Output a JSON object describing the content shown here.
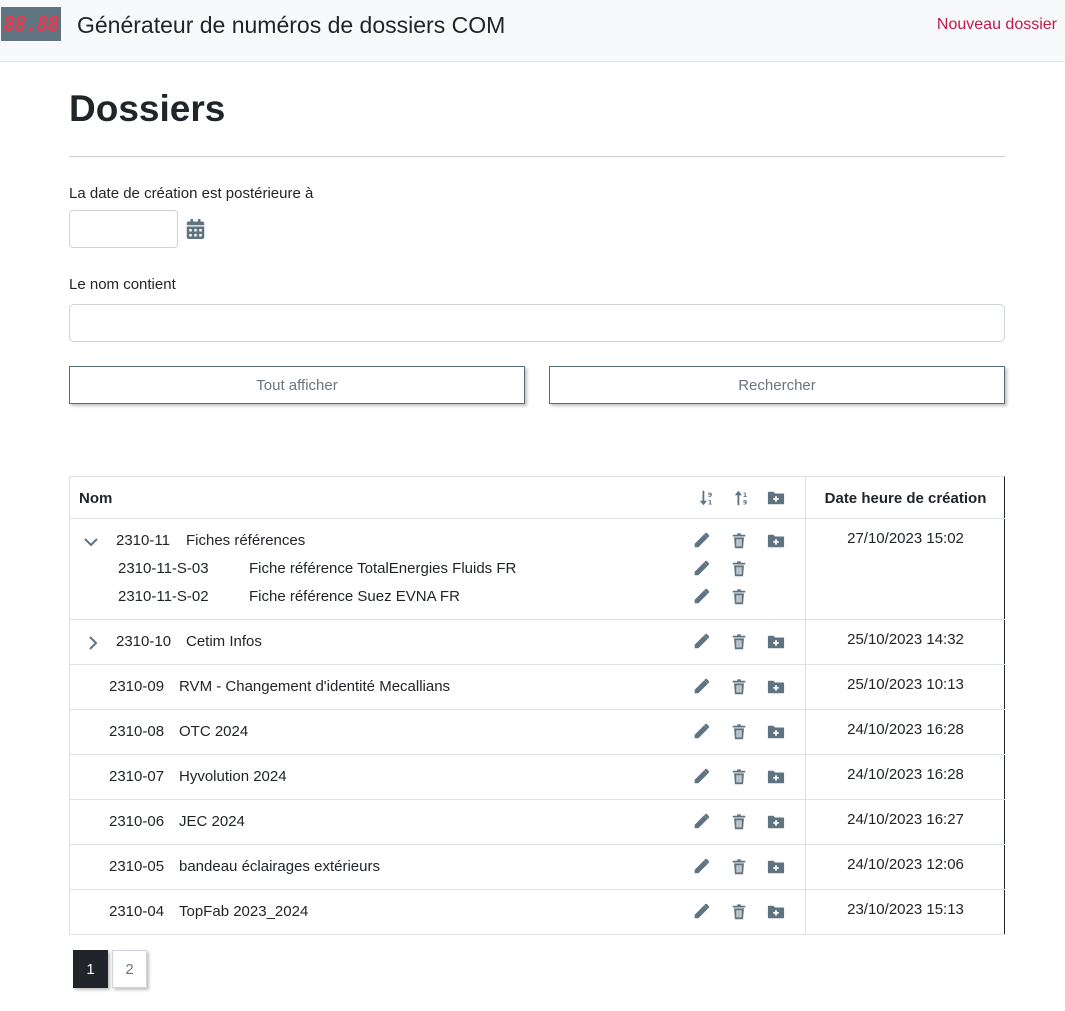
{
  "header": {
    "logo_text": "88.88",
    "title": "Générateur de numéros de dossiers COM",
    "new_link": "Nouveau dossier"
  },
  "page": {
    "title": "Dossiers"
  },
  "filters": {
    "date_label": "La date de création est postérieure à",
    "date_value": "",
    "name_label": "Le nom contient",
    "name_value": ""
  },
  "buttons": {
    "show_all": "Tout afficher",
    "search": "Rechercher"
  },
  "table": {
    "col_name": "Nom",
    "col_date": "Date heure de création",
    "rows": [
      {
        "code": "2310-11",
        "name": "Fiches références",
        "date": "27/10/2023 15:02",
        "expanded": true,
        "children": [
          {
            "code": "2310-11-S-03",
            "name": "Fiche référence TotalEnergies Fluids FR"
          },
          {
            "code": "2310-11-S-02",
            "name": "Fiche référence Suez EVNA FR"
          }
        ]
      },
      {
        "code": "2310-10",
        "name": "Cetim Infos",
        "date": "25/10/2023 14:32",
        "expanded": false
      },
      {
        "code": "2310-09",
        "name": "RVM - Changement d'identité Mecallians",
        "date": "25/10/2023 10:13"
      },
      {
        "code": "2310-08",
        "name": "OTC 2024",
        "date": "24/10/2023 16:28"
      },
      {
        "code": "2310-07",
        "name": "Hyvolution 2024",
        "date": "24/10/2023 16:28"
      },
      {
        "code": "2310-06",
        "name": "JEC 2024",
        "date": "24/10/2023 16:27"
      },
      {
        "code": "2310-05",
        "name": "bandeau éclairages extérieurs",
        "date": "24/10/2023 12:06"
      },
      {
        "code": "2310-04",
        "name": "TopFab 2023_2024",
        "date": "23/10/2023 15:13"
      }
    ]
  },
  "pagination": {
    "pages": [
      "1",
      "2"
    ],
    "current": "1"
  },
  "colors": {
    "accent": "#c2174a",
    "icon": "#5f7380",
    "text": "#212529"
  }
}
